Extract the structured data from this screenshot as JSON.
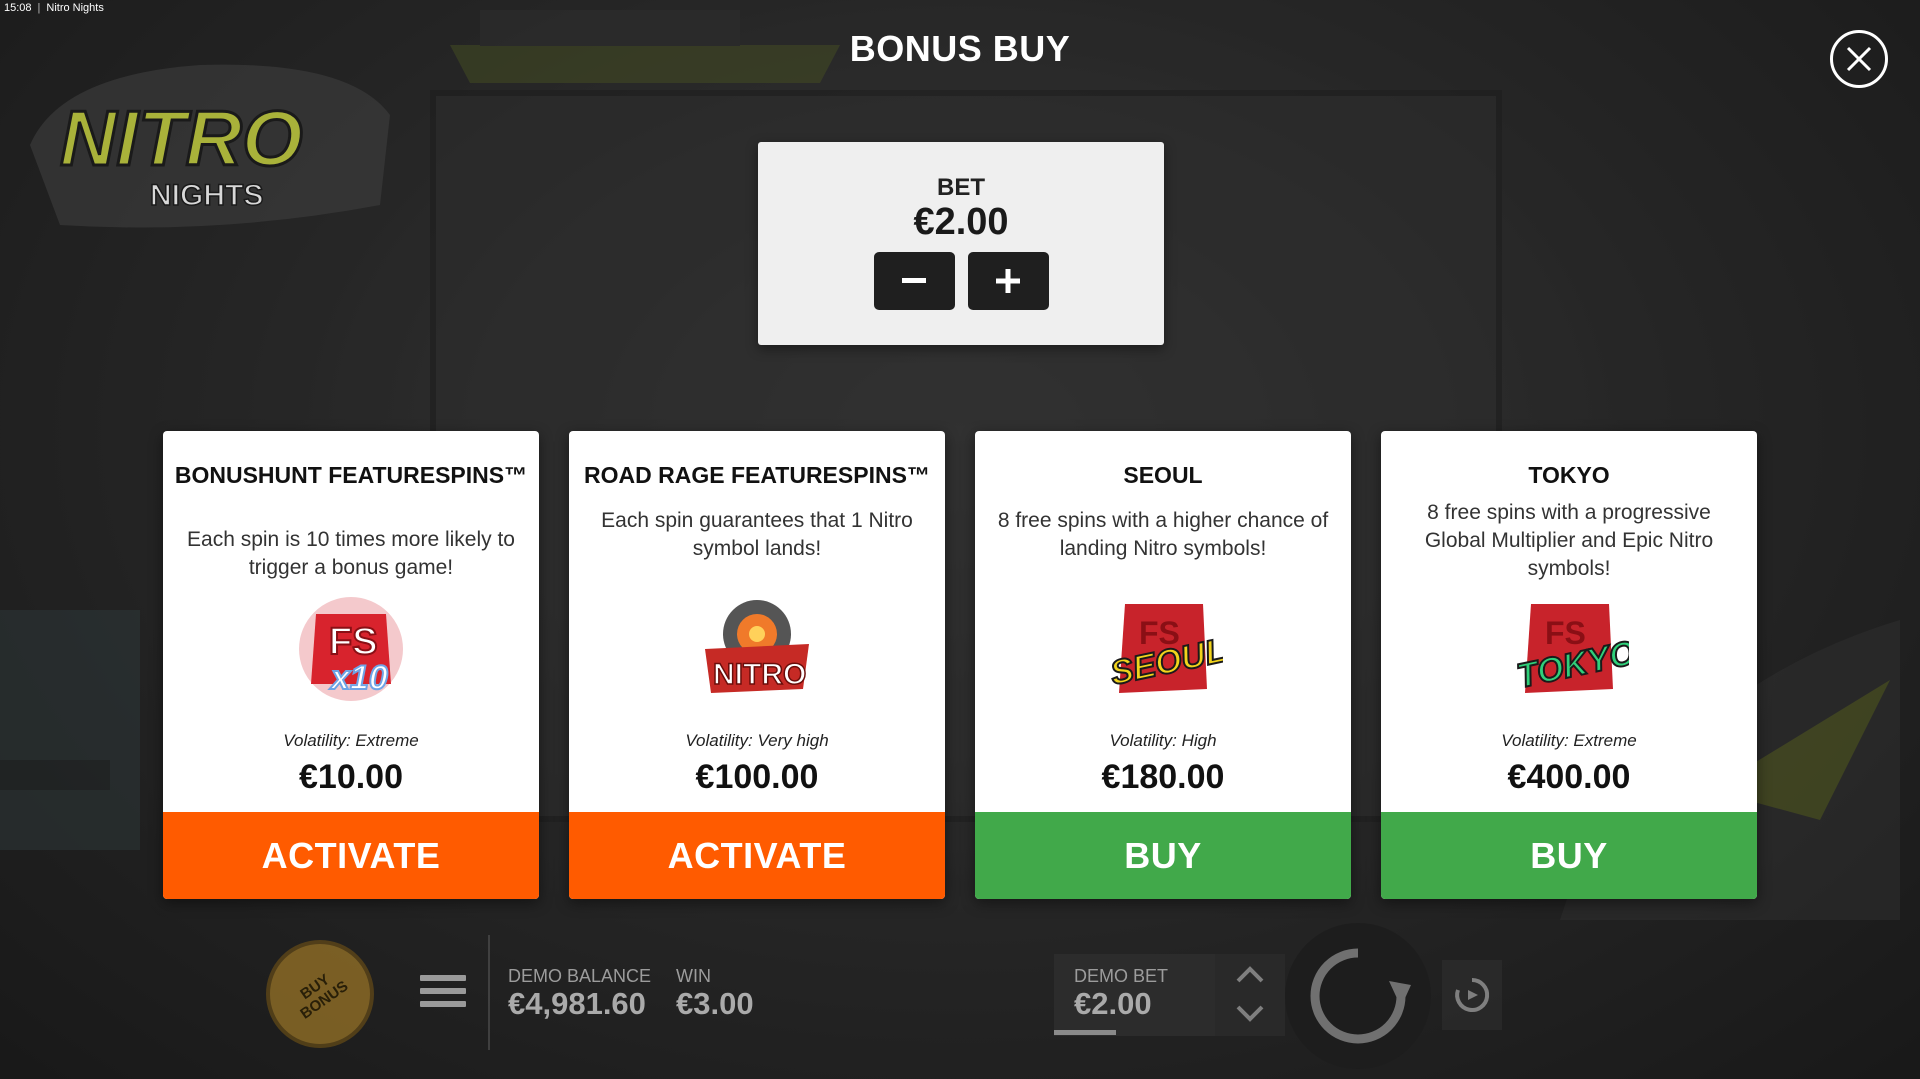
{
  "window": {
    "time": "15:08",
    "title": "Nitro Nights"
  },
  "logo": {
    "word1": "NITRO",
    "word2": "NIGHTS"
  },
  "dialog": {
    "title": "BONUS BUY",
    "close_icon": "close-icon"
  },
  "bet": {
    "label": "BET",
    "value": "€2.00",
    "decrease_icon": "minus-icon",
    "increase_icon": "plus-icon"
  },
  "options": [
    {
      "title": "BONUSHUNT FEATURESPINS™",
      "description": "Each spin is 10 times more likely to trigger a bonus game!",
      "icon": "fs-x10-icon",
      "icon_text": "x10",
      "volatility": "Volatility: Extreme",
      "price": "€10.00",
      "action": "ACTIVATE",
      "action_color": "#ff5b00"
    },
    {
      "title": "ROAD RAGE FEATURESPINS™",
      "description": "Each spin guarantees that 1 Nitro symbol lands!",
      "icon": "nitro-icon",
      "icon_text": "NITRO",
      "volatility": "Volatility: Very high",
      "price": "€100.00",
      "action": "ACTIVATE",
      "action_color": "#ff5b00"
    },
    {
      "title": "SEOUL",
      "description": "8 free spins with a higher chance of landing Nitro symbols!",
      "icon": "seoul-icon",
      "icon_text": "SEOUL",
      "volatility": "Volatility: High",
      "price": "€180.00",
      "action": "BUY",
      "action_color": "#41a94a"
    },
    {
      "title": "TOKYO",
      "description": "8 free spins with a progressive Global Multiplier and Epic Nitro symbols!",
      "icon": "tokyo-icon",
      "icon_text": "TOKYO",
      "volatility": "Volatility: Extreme",
      "price": "€400.00",
      "action": "BUY",
      "action_color": "#41a94a"
    }
  ],
  "bottom": {
    "buy_bonus_label": "BUY BONUS",
    "menu_icon": "menu-icon",
    "balance_label": "DEMO BALANCE",
    "balance_value": "€4,981.60",
    "win_label": "WIN",
    "win_value": "€3.00",
    "bet_label": "DEMO BET",
    "bet_value": "€2.00",
    "spin_icon": "spin-icon",
    "autoplay_icon": "autoplay-icon"
  }
}
